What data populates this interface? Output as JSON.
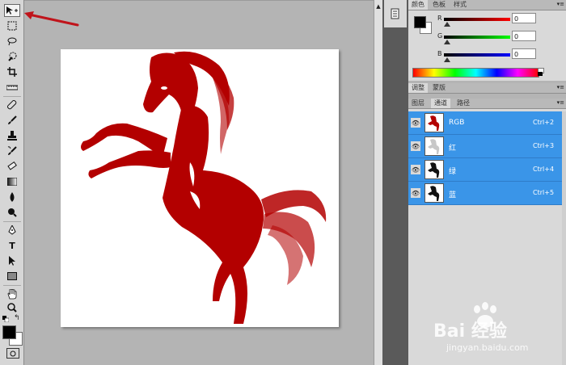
{
  "toolbar": {
    "tools": [
      "move-tool",
      "rectangular-marquee-tool",
      "lasso-tool",
      "quick-selection-tool",
      "crop-tool",
      "eyedropper-tool",
      "spot-healing-brush-tool",
      "brush-tool",
      "clone-stamp-tool",
      "history-brush-tool",
      "eraser-tool",
      "gradient-tool",
      "blur-tool",
      "dodge-tool",
      "pen-tool",
      "type-tool",
      "path-selection-tool",
      "rectangle-tool",
      "hand-tool",
      "zoom-tool"
    ],
    "type_glyph": "T"
  },
  "color_panel": {
    "tabs": [
      "颜色",
      "色板",
      "样式"
    ],
    "channels": [
      {
        "label": "R",
        "value": "0",
        "color": "#c00000"
      },
      {
        "label": "G",
        "value": "0",
        "color": "#00a000"
      },
      {
        "label": "B",
        "value": "0",
        "color": "#0000c0"
      }
    ]
  },
  "adjustments_panel": {
    "tabs": [
      "调整",
      "蒙版"
    ]
  },
  "layers_panel": {
    "tabs": [
      "图层",
      "通道",
      "路径"
    ],
    "channels": [
      {
        "name": "RGB",
        "shortcut": "Ctrl+2"
      },
      {
        "name": "红",
        "shortcut": "Ctrl+3"
      },
      {
        "name": "绿",
        "shortcut": "Ctrl+4"
      },
      {
        "name": "蓝",
        "shortcut": "Ctrl+5"
      }
    ]
  },
  "watermark": {
    "brand": "Bai 经验",
    "url": "jingyan.baidu.com"
  },
  "colors": {
    "horse": "#b30000",
    "selection": "#3a95e8",
    "annotation_arrow": "#c0141b"
  }
}
